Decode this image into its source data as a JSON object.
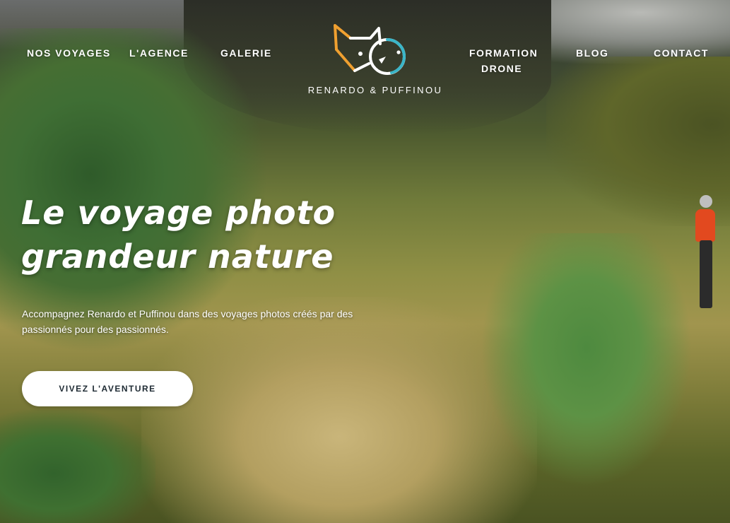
{
  "nav": {
    "items": [
      {
        "label": "NOS VOYAGES"
      },
      {
        "label": "L'AGENCE"
      },
      {
        "label": "GALERIE"
      },
      {
        "label_line1": "FORMATION",
        "label_line2": "DRONE"
      },
      {
        "label": "BLOG"
      },
      {
        "label": "CONTACT"
      }
    ]
  },
  "logo": {
    "icon": "fox-and-puffin-logo-icon",
    "text": "RENARDO & PUFFINOU",
    "colors": {
      "fox": "#f0a030",
      "puffin": "#3ab5c8",
      "outline": "#ffffff"
    }
  },
  "hero": {
    "headline_line1": "Le voyage photo",
    "headline_line2": "grandeur nature",
    "subtext": "Accompagnez Renardo et Puffinou dans des voyages photos créés par des passionnés pour des passionnés.",
    "cta_label": "VIVEZ L'AVENTURE"
  }
}
